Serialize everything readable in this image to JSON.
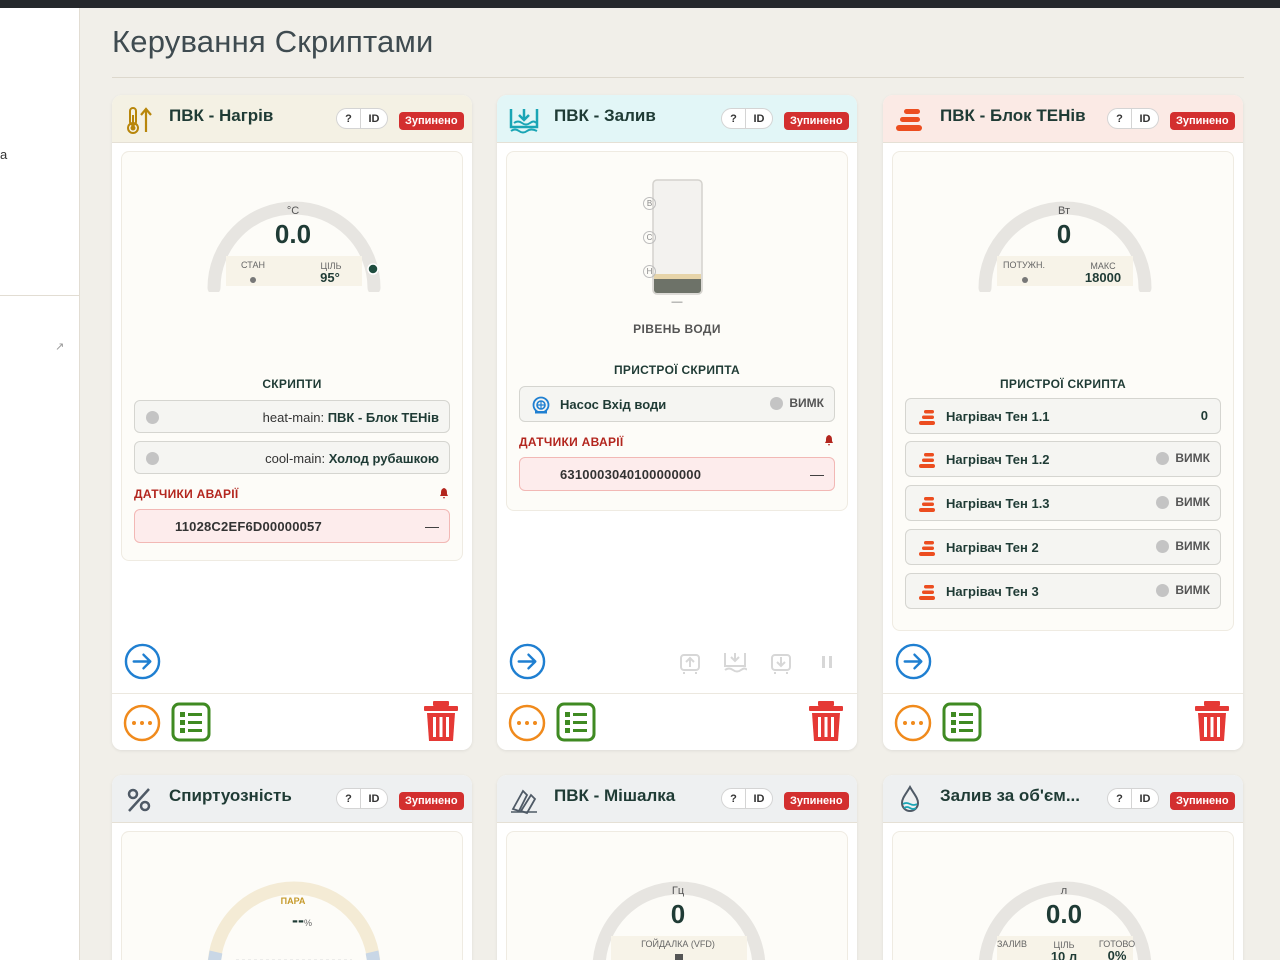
{
  "page": {
    "title": "Керування Скриптами",
    "sidebar_fragment": "а"
  },
  "common": {
    "help_label": "?",
    "id_label": "ID",
    "status_label": "Зупинено",
    "alarm_dash": "—"
  },
  "cards": {
    "heat": {
      "title": "ПВК - Нагрів",
      "gauge": {
        "unit": "°C",
        "value": "0.0",
        "state_label": "СТАН",
        "target_label": "ЦІЛЬ",
        "target_value": "95°"
      },
      "scripts_label": "СКРИПТИ",
      "scripts": [
        {
          "id": "heat-main:",
          "name": "ПВК - Блок ТЕНів"
        },
        {
          "id": "cool-main:",
          "name": "Холод рубашкою"
        }
      ],
      "alarms_label": "ДАТЧИКИ АВАРІЇ",
      "alarm_sensor": "11028C2EF6D00000057"
    },
    "fill": {
      "title": "ПВК - Залив",
      "tank": {
        "mark_top": "В",
        "mark_mid": "С",
        "mark_low": "Н",
        "dash": "—",
        "label": "РІВЕНЬ ВОДИ"
      },
      "devices_label": "ПРИСТРОЇ СКРИПТА",
      "device": {
        "name": "Насос Вхід води",
        "state": "ВИМК"
      },
      "alarms_label": "ДАТЧИКИ АВАРІЇ",
      "alarm_sensor": "6310003040100000000"
    },
    "block": {
      "title": "ПВК - Блок ТЕНів",
      "gauge": {
        "unit": "Вт",
        "value": "0",
        "power_label": "ПОТУЖН.",
        "max_label": "МАКС",
        "max_value": "18000"
      },
      "devices_label": "ПРИСТРОЇ СКРИПТА",
      "devices": [
        {
          "name": "Нагрівач Тен 1.1",
          "state": "0"
        },
        {
          "name": "Нагрівач Тен 1.2",
          "state": "ВИМК"
        },
        {
          "name": "Нагрівач Тен 1.3",
          "state": "ВИМК"
        },
        {
          "name": "Нагрівач Тен 2",
          "state": "ВИМК"
        },
        {
          "name": "Нагрівач Тен 3",
          "state": "ВИМК"
        }
      ]
    },
    "alcohol": {
      "title": "Спиртуозність",
      "gauge": {
        "label": "ПАРА",
        "value": "--",
        "unit": "%"
      }
    },
    "mixer": {
      "title": "ПВК - Мішалка",
      "gauge": {
        "unit": "Гц",
        "value": "0",
        "sub_label": "ГОЙДАЛКА (VFD)"
      }
    },
    "volume": {
      "title": "Залив за об'єм...",
      "gauge": {
        "unit": "л",
        "value": "0.0",
        "fill_label": "ЗАЛИВ",
        "target_label": "ЦІЛЬ",
        "target_value": "10 л",
        "done_label": "ГОТОВО",
        "done_value": "0%"
      }
    }
  },
  "colors": {
    "accent_blue": "#1f7fd1",
    "orange": "#f08a1c",
    "green": "#3f8a22",
    "red": "#e53935",
    "status_red": "#d32f2f",
    "dark_green": "#1f3b35"
  }
}
